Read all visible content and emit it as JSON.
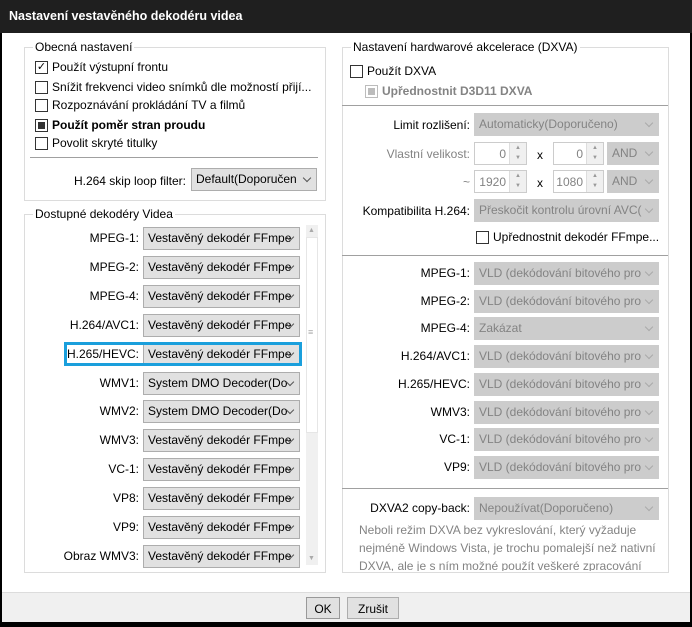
{
  "window": {
    "title": "Nastavení vestavěného dekodéru videa"
  },
  "general": {
    "title": "Obecná nastavení",
    "options": [
      {
        "label": "Použít výstupní frontu",
        "state": "checked"
      },
      {
        "label": "Snížit frekvenci video snímků dle možností přijí...",
        "state": "unchecked"
      },
      {
        "label": "Rozpoznávání prokládání TV a filmů",
        "state": "unchecked"
      },
      {
        "label": "Použít poměr stran proudu",
        "state": "indeterminate"
      },
      {
        "label": "Povolit skryté titulky",
        "state": "unchecked"
      }
    ],
    "skip_loop_label": "H.264 skip loop filter:",
    "skip_loop_value": "Default(Doporučen"
  },
  "decoders": {
    "title": "Dostupné dekodéry Videa",
    "rows": [
      {
        "label": "MPEG-1:",
        "value": "Vestavěný dekodér FFmpe"
      },
      {
        "label": "MPEG-2:",
        "value": "Vestavěný dekodér FFmpe"
      },
      {
        "label": "MPEG-4:",
        "value": "Vestavěný dekodér FFmpe"
      },
      {
        "label": "H.264/AVC1:",
        "value": "Vestavěný dekodér FFmpe"
      },
      {
        "label": "H.265/HEVC:",
        "value": "Vestavěný dekodér FFmpe"
      },
      {
        "label": "WMV1:",
        "value": "System DMO Decoder(Do"
      },
      {
        "label": "WMV2:",
        "value": "System DMO Decoder(Do"
      },
      {
        "label": "WMV3:",
        "value": "Vestavěný dekodér FFmpe"
      },
      {
        "label": "VC-1:",
        "value": "Vestavěný dekodér FFmpe"
      },
      {
        "label": "VP8:",
        "value": "Vestavěný dekodér FFmpe"
      },
      {
        "label": "VP9:",
        "value": "Vestavěný dekodér FFmpe"
      },
      {
        "label": "Obraz WMV3:",
        "value": "Vestavěný dekodér FFmpe"
      }
    ],
    "highlight_color": "#1a9fdc"
  },
  "dxva": {
    "title": "Nastavení hardwarové akcelerace (DXVA)",
    "use_dxva": "Použít DXVA",
    "prefer_d3d11": "Upřednostnit D3D11 DXVA",
    "limit_label": "Limit rozlišení:",
    "limit_value": "Automaticky(Doporučeno)",
    "custom_label": "Vlastní velikost:",
    "w1": "0",
    "h1": "0",
    "op1": "AND",
    "tilde": "~",
    "w2": "1920",
    "h2": "1080",
    "op2": "AND",
    "x": "x",
    "compat_label": "Kompatibilita H.264:",
    "compat_value": "Přeskočit kontrolu úrovní AVC(",
    "prefer_ffmpeg": "Upřednostnit dekodér FFmpe...",
    "rows": [
      {
        "label": "MPEG-1:",
        "value": "VLD (dekódování bitového pro"
      },
      {
        "label": "MPEG-2:",
        "value": "VLD (dekódování bitového pro"
      },
      {
        "label": "MPEG-4:",
        "value": "Zakázat"
      },
      {
        "label": "H.264/AVC1:",
        "value": "VLD (dekódování bitového pro"
      },
      {
        "label": "H.265/HEVC:",
        "value": "VLD (dekódování bitového pro"
      },
      {
        "label": "WMV3:",
        "value": "VLD (dekódování bitového pro"
      },
      {
        "label": "VC-1:",
        "value": "VLD (dekódování bitového pro"
      },
      {
        "label": "VP9:",
        "value": "VLD (dekódování bitového pro"
      }
    ],
    "copyback_label": "DXVA2 copy-back:",
    "copyback_value": "Nepoužívat(Doporučeno)",
    "desc": [
      "Neboli režim DXVA bez vykreslování, který vyžaduje",
      "nejméně Windows Vista, je trochu pomalejší než nativní",
      "DXVA, ale je s ním možné použít veškeré zpracování"
    ]
  },
  "buttons": {
    "ok": "OK",
    "cancel": "Zrušit"
  }
}
